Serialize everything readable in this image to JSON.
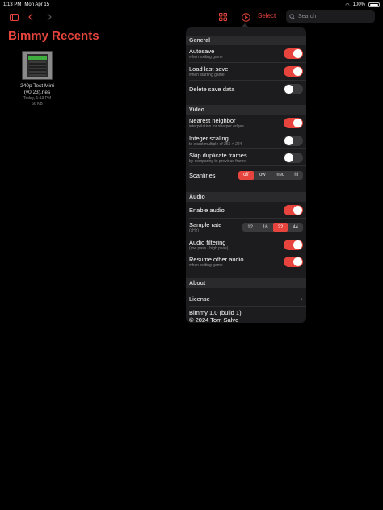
{
  "status": {
    "time": "1:13 PM",
    "date": "Mon Apr 15",
    "battery": "100%"
  },
  "toolbar": {
    "select_label": "Select",
    "search_placeholder": "Search"
  },
  "page": {
    "title": "Bimmy Recents"
  },
  "games": [
    {
      "name": "240p Test Mini (v0.23).nes",
      "date": "Today, 1:13 PM",
      "size": "66 KB"
    }
  ],
  "settings": {
    "general": {
      "header": "General",
      "autosave": {
        "title": "Autosave",
        "subtitle": "when exiting game",
        "on": true
      },
      "load_last": {
        "title": "Load last save",
        "subtitle": "when starting game",
        "on": true
      },
      "delete_save": {
        "title": "Delete save data",
        "on": false
      }
    },
    "video": {
      "header": "Video",
      "nearest": {
        "title": "Nearest neighbor",
        "subtitle": "interpolation for sharper edges",
        "on": true
      },
      "integer": {
        "title": "Integer scaling",
        "subtitle": "to exact multiple of 256 × 224",
        "on": false
      },
      "skip_dup": {
        "title": "Skip duplicate frames",
        "subtitle": "by comparing to previous frame",
        "on": false
      },
      "scanlines": {
        "title": "Scanlines",
        "options": [
          "off",
          "low",
          "med",
          "hi"
        ],
        "selected": "off"
      }
    },
    "audio": {
      "header": "Audio",
      "enable": {
        "title": "Enable audio",
        "on": true
      },
      "sample_rate": {
        "title": "Sample rate",
        "subtitle": "(kHz)",
        "options": [
          "12",
          "16",
          "22",
          "44"
        ],
        "selected": "22"
      },
      "filtering": {
        "title": "Audio filtering",
        "subtitle": "(low pass / high pass)",
        "on": true
      },
      "resume_other": {
        "title": "Resume other audio",
        "subtitle": "when exiting game",
        "on": true
      }
    },
    "about": {
      "header": "About",
      "license": "License",
      "version": "Bimmy 1.0 (build 1)",
      "copyright": "© 2024 Tom Salvo"
    }
  },
  "colors": {
    "accent": "#e6443c",
    "popover_bg": "#1c1c1e",
    "section_bg": "#2a2a2c"
  }
}
